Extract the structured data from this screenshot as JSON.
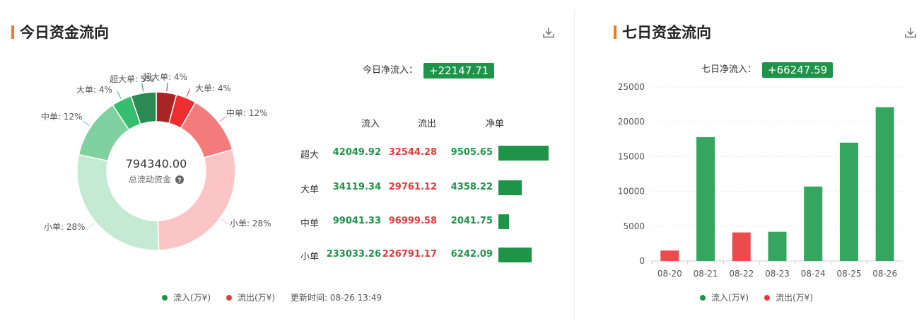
{
  "today": {
    "title": "今日资金流向",
    "net_label": "今日净流入：",
    "net_value": "+22147.71",
    "center_value": "794340.00",
    "center_label": "总流动资金",
    "table_headers": [
      "流入",
      "流出",
      "净单"
    ],
    "rows": [
      {
        "label": "超大",
        "in": "42049.92",
        "out": "32544.28",
        "net": "9505.65"
      },
      {
        "label": "大单",
        "in": "34119.34",
        "out": "29761.12",
        "net": "4358.22"
      },
      {
        "label": "中单",
        "in": "99041.33",
        "out": "96999.58",
        "net": "2041.75"
      },
      {
        "label": "小单",
        "in": "233033.26",
        "out": "226791.17",
        "net": "6242.09"
      }
    ],
    "legend_in": "流入(万¥)",
    "legend_out": "流出(万¥)",
    "update_time": "更新时间: 08-26 13:49"
  },
  "week": {
    "title": "七日资金流向",
    "net_label": "七日净流入：",
    "net_value": "+66247.59",
    "legend_in": "流入(万¥)",
    "legend_out": "流出(万¥)"
  },
  "colors": {
    "accent": "#f47920",
    "inflow": "#1e9448",
    "outflow": "#e33b3b",
    "bar_in": "#35a660",
    "bar_out": "#eb4b4b"
  },
  "chart_data": [
    {
      "type": "pie",
      "donut": true,
      "slices": [
        {
          "label": "超大单: 4%",
          "value": 4,
          "color": "#a82525",
          "flow": "out"
        },
        {
          "label": "大单: 4%",
          "value": 4,
          "color": "#ee2e2e",
          "flow": "out"
        },
        {
          "label": "中单: 12%",
          "value": 12,
          "color": "#f37b7b",
          "flow": "out"
        },
        {
          "label": "小单: 28%",
          "value": 28,
          "color": "#fbc5c5",
          "flow": "out"
        },
        {
          "label": "小单: 28%",
          "value": 28,
          "color": "#c4ead3",
          "flow": "in"
        },
        {
          "label": "中单: 12%",
          "value": 12,
          "color": "#7fd1a0",
          "flow": "in"
        },
        {
          "label": "大单: 4%",
          "value": 4,
          "color": "#36bd6e",
          "flow": "in"
        },
        {
          "label": "超大单: 5%",
          "value": 5,
          "color": "#2b8a52",
          "flow": "in"
        }
      ]
    },
    {
      "type": "bar",
      "categories": [
        "08-20",
        "08-21",
        "08-22",
        "08-23",
        "08-24",
        "08-25",
        "08-26"
      ],
      "values": [
        1500,
        17800,
        4100,
        4200,
        10700,
        17000,
        22100
      ],
      "flow": [
        "out",
        "in",
        "out",
        "in",
        "in",
        "in",
        "in"
      ],
      "ylim": [
        0,
        25000
      ],
      "yticks": [
        0,
        5000,
        10000,
        15000,
        20000,
        25000
      ],
      "grid": true
    }
  ]
}
